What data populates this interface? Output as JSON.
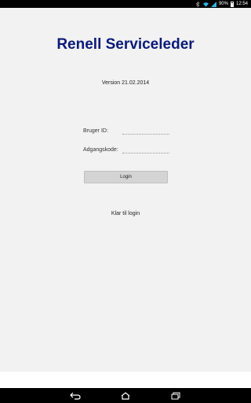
{
  "status_bar": {
    "battery_percent": "90%",
    "time": "12:54",
    "icons": [
      "bluetooth-icon",
      "wifi-icon",
      "signal-icon",
      "battery-icon"
    ]
  },
  "app": {
    "title": "Renell Serviceleder",
    "version": "Version 21.02.2014",
    "form": {
      "user_label": "Bruger ID:",
      "user_value": "",
      "password_label": "Adgangskode:",
      "password_value": ""
    },
    "login_button": "Login",
    "status": "Klar til login",
    "title_color": "#0a1a7a"
  },
  "nav_bar": {
    "icons": [
      "back-icon",
      "home-icon",
      "recent-apps-icon"
    ]
  }
}
